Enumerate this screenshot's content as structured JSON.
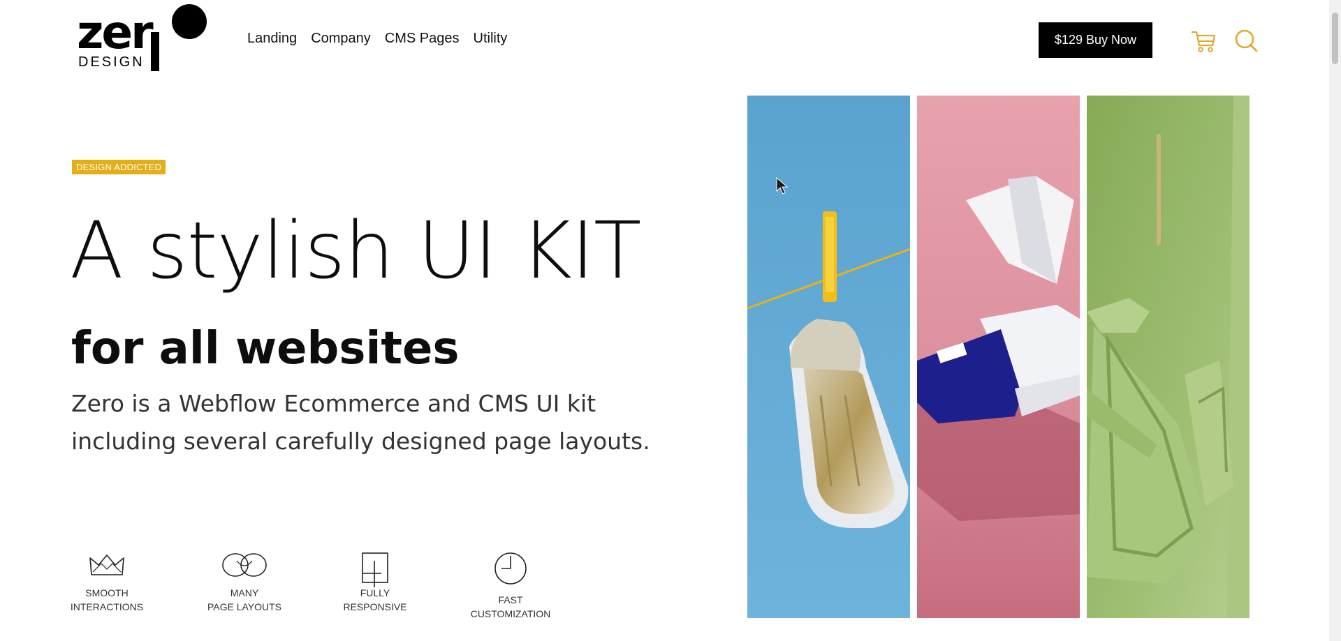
{
  "brand": {
    "logo_word": "zer",
    "logo_sub": "DESIGN"
  },
  "nav": {
    "items": [
      {
        "label": "Landing"
      },
      {
        "label": "Company"
      },
      {
        "label": "CMS Pages"
      },
      {
        "label": "Utility"
      }
    ]
  },
  "header": {
    "buy_label": "$129 Buy Now",
    "cart_icon": "cart-icon",
    "search_icon": "search-icon"
  },
  "hero": {
    "badge": "DESIGN ADDICTED",
    "title": "A stylish UI KIT",
    "subtitle": "for all websites",
    "description": "Zero is a Webflow Ecommerce and CMS UI kit including several carefully designed page layouts."
  },
  "features": [
    {
      "icon": "crown-icon",
      "line1": "SMOOTH",
      "line2": "INTERACTIONS"
    },
    {
      "icon": "infinity-icon",
      "line1": "MANY",
      "line2": "PAGE LAYOUTS"
    },
    {
      "icon": "responsive-icon",
      "line1": "FULLY",
      "line2": "RESPONSIVE"
    },
    {
      "icon": "clock-icon",
      "line1": "FAST",
      "line2": "CUSTOMIZATION"
    }
  ],
  "colors": {
    "accent": "#e4ae17",
    "icon_gold": "#e0a82e",
    "panel_blue": "#62a8d2",
    "panel_pink": "#e29aa4",
    "panel_green": "#9bbd6e"
  }
}
